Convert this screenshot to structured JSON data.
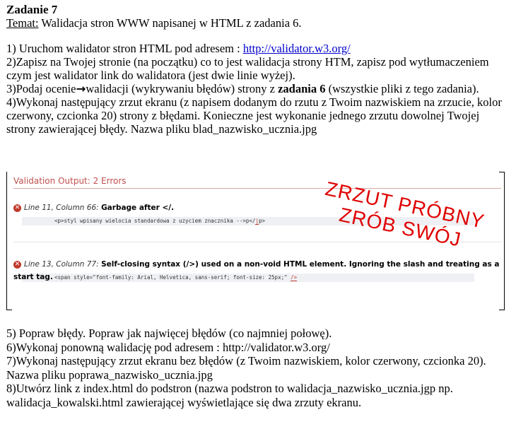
{
  "header": {
    "title": "Zadanie 7",
    "topic_label": "Temat:",
    "topic_text": " Walidacja stron WWW napisanej w HTML z zadania 6."
  },
  "steps_top": {
    "s1_text": "1) Uruchom walidator stron HTML pod adresem : ",
    "s1_link": "http://validator.w3.org/",
    "s2": "2)Zapisz na Twojej stronie (na początku) co to jest walidacja strony HTM, zapisz pod wytłumaczeniem czym jest walidator  link do walidatora (jest dwie linie wyżej).",
    "s3_a": "3)Podaj ocenie",
    "s3_arrow": "→",
    "s3_b": "walidacji (wykrywaniu błędów) strony z ",
    "s3_bold": "zadania 6",
    "s3_c": " (wszystkie pliki z tego zadania).",
    "s4": "4)Wykonaj następujący zrzut ekranu (z napisem dodanym do rzutu z Twoim nazwiskiem na zrzucie, kolor czerwony, czcionka 20) strony z błędami. Konieczne jest wykonanie jednego zrzutu dowolnej Twojej strony zawierającej błędy. Nazwa pliku blad_nazwisko_ucznia.jpg"
  },
  "screenshot": {
    "header": "Validation Output: 2 Errors",
    "stamp_line1": "ZRZUT PRÓBNY",
    "stamp_line2": "ZRÓB SWÓJ",
    "errors": [
      {
        "icon": "✕",
        "location": "Line 11, Column 66",
        "message": "Garbage after </.",
        "code_pre": "<p>styl wpisany wielocia standardowa z uzyciem znacznika -->p</",
        "code_hl": "|",
        "code_post": "p>"
      },
      {
        "icon": "✕",
        "location": "Line 13, Column 77",
        "message": "Self-closing syntax (/>) used on a non-void HTML element. Ignoring the slash and treating as a start tag.",
        "code_pre": "<span style=\"font-family: Arial, Helvetica, sans-serif; font-size: 25px;\" ",
        "code_hl": "/>",
        "code_post": ""
      }
    ],
    "colors": {
      "header": "#c0504d",
      "stamp": "#e00000",
      "error_icon": "#c0392b"
    }
  },
  "steps_bottom": {
    "s5": "5) Popraw błędy. Popraw jak najwięcej błędów (co najmniej połowę).",
    "s6": "6)Wykonaj ponowną walidację pod adresem : http://validator.w3.org/",
    "s7": "7)Wykonaj następujący zrzut ekranu bez błędów (z Twoim nazwiskiem, kolor czerwony, czcionka 20). Nazwa pliku poprawa_nazwisko_ucznia.jpg",
    "s8": "8)Utwórz link z index.html do podstron (nazwa podstron to walidacja_nazwisko_ucznia.jgp np. walidacja_kowalski.html zawierającej wyświetlające się dwa zrzuty ekranu."
  }
}
